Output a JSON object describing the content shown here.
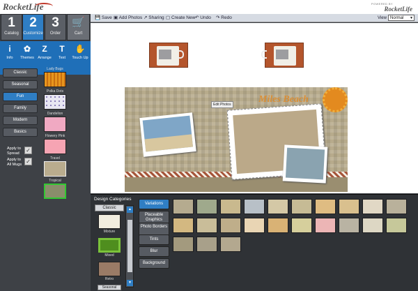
{
  "brand": {
    "logo": "RocketLife",
    "powered": "POWERED BY",
    "logo_small": "RocketLife"
  },
  "steps": [
    {
      "num": "1",
      "label": "Catalog"
    },
    {
      "num": "2",
      "label": "Customize"
    },
    {
      "num": "3",
      "label": "Order"
    },
    {
      "num": "",
      "label": "Cart"
    }
  ],
  "tools": [
    {
      "icon": "i",
      "label": "Info"
    },
    {
      "icon": "✿",
      "label": "Themes"
    },
    {
      "icon": "Z",
      "label": "Arrange"
    },
    {
      "icon": "T",
      "label": "Text"
    },
    {
      "icon": "✋",
      "label": "Touch Up"
    }
  ],
  "categories": [
    "Classic",
    "Seasonal",
    "Fun",
    "Family",
    "Modern",
    "Basics"
  ],
  "apply": {
    "spread": "Apply to Spread",
    "all": "Apply to All Mugs"
  },
  "themes": [
    "Lady Bugs",
    "Polka Dots",
    "Dandelion",
    "Flowery Pink",
    "Travel",
    "Tropical"
  ],
  "toolbar": {
    "save": "Save",
    "add": "Add Photos",
    "share": "Sharing",
    "create": "Create New",
    "undo": "Undo",
    "redo": "Redo",
    "view_label": "View",
    "view_value": "Normal"
  },
  "canvas": {
    "title": "Miles Beach",
    "tip": "Edit Photos"
  },
  "bottom": {
    "title": "Design Categories",
    "classic": "Classic",
    "items": [
      "Mixture",
      "Mixed",
      "Retro",
      "Seasonal"
    ],
    "buttons": [
      "Variations",
      "Placeable Graphics",
      "Photo Borders",
      "Tints",
      "Blur",
      "Background"
    ]
  },
  "colors": {
    "accent": "#2f7ec4",
    "panel": "#3e4146"
  }
}
